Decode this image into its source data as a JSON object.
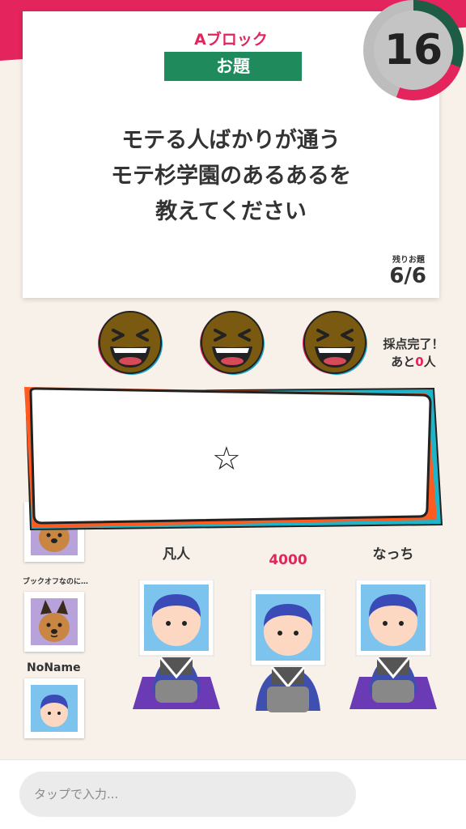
{
  "header": {
    "block": "Aブロック",
    "topic_tag": "お題"
  },
  "question": "モテる人ばかりが通う\nモテ杉学園のあるあるを\n教えてください",
  "remaining": {
    "label": "残りお題",
    "count": "6/6"
  },
  "timer": {
    "seconds": "16"
  },
  "judges": {
    "status_line1": "採点完了！",
    "status_prefix": "あと",
    "status_count": "0",
    "status_suffix": "人"
  },
  "answer": {
    "rating_icon": "☆"
  },
  "side_players": [
    {
      "name": "ブックオフなのに…"
    },
    {
      "name": "NoName"
    }
  ],
  "players": [
    {
      "label": "凡人"
    },
    {
      "label": "4000"
    },
    {
      "label": "なっち"
    }
  ],
  "input": {
    "placeholder": "タップで入力..."
  },
  "colors": {
    "accent": "#e3245d",
    "topic_green": "#1f8a5c",
    "answer_orange": "#ff5a1f",
    "answer_cyan": "#1fb5c9"
  }
}
